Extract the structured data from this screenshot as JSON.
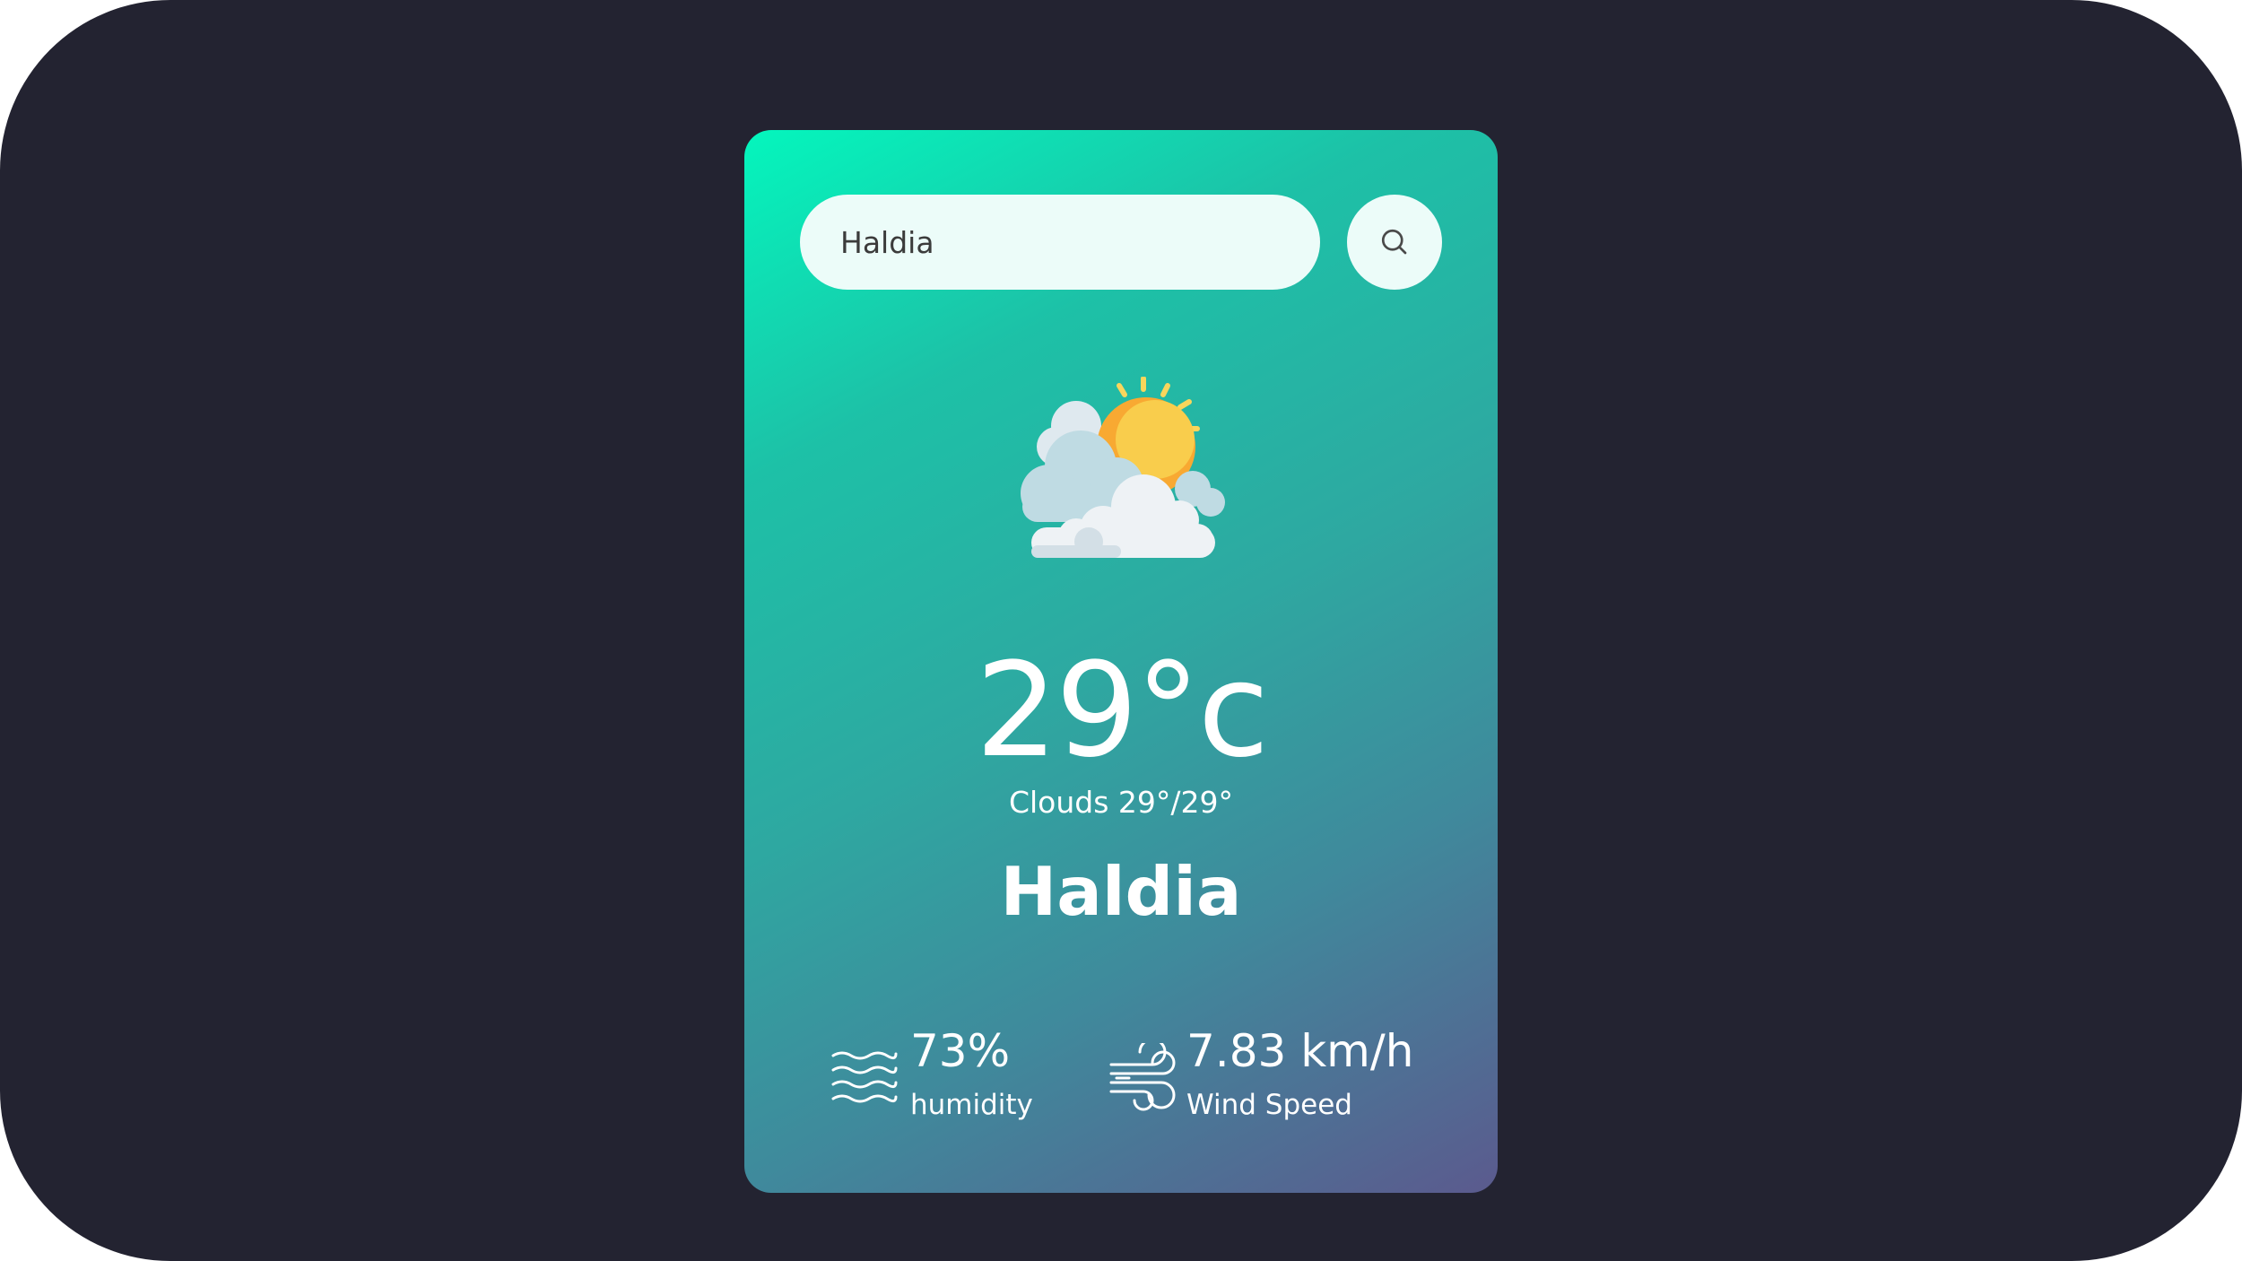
{
  "search": {
    "value": "Haldia",
    "icon": "search-icon"
  },
  "weather": {
    "icon": "partly-cloudy-icon",
    "temperature": "29°c",
    "description": "Clouds 29°/29°",
    "city": "Haldia"
  },
  "stats": {
    "humidity": {
      "icon": "humidity-waves-icon",
      "value": "73%",
      "label": "humidity"
    },
    "wind": {
      "icon": "wind-icon",
      "value": "7.83 km/h",
      "label": "Wind Speed"
    }
  },
  "colors": {
    "page_background": "#232331",
    "card_gradient_start": "#04f6bd",
    "card_gradient_end": "#5b5a8e",
    "input_background": "#ecfcf9",
    "text": "#ffffff"
  }
}
